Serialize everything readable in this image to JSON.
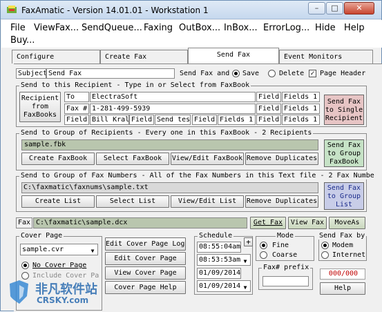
{
  "window": {
    "title": "FaxAmatic - Version 14.01.01 - Workstation 1"
  },
  "menu": [
    "File",
    "ViewFax...",
    "SendQueue...",
    "Faxing",
    "OutBox...",
    "InBox...",
    "ErrorLog...",
    "Hide",
    "Help",
    "Buy..."
  ],
  "tabs": [
    "Configure",
    "Create Fax",
    "Send Fax",
    "Event Monitors"
  ],
  "subject": {
    "label": "Subject",
    "value": "Send Fax"
  },
  "send_fax_and": "Send Fax and",
  "save_label": "Save",
  "delete_label": "Delete",
  "page_header_label": "Page Header",
  "recipient": {
    "caption": "Send to this Recipient - Type in or Select from FaxBook",
    "faxbooks_button": "Recipient from FaxBooks",
    "to_label": "To",
    "to_value": "ElectraSoft",
    "faxnum_label": "Fax #",
    "faxnum_value": "1-281-499-5939",
    "field_label": "Field",
    "field_value_1": "Bill Kral",
    "field_value_2": "Send tes",
    "field_value_3": "Fields 1",
    "right_fields": [
      "Fields 1",
      "Fields 1"
    ],
    "single_button": "Send Fax to Single Recipient"
  },
  "group": {
    "caption": "Send to Group of Recipients - Every one in this FaxBook - 2 Recipients",
    "file": "sample.fbk",
    "buttons": [
      "Create FaxBook",
      "Select FaxBook",
      "View/Edit FaxBook",
      "Remove Duplicates"
    ],
    "send_button": "Send Fax to Group FaxBook"
  },
  "numbers": {
    "caption": "Send to Group of Fax Numbers - All of the Fax Numbers in this Text file - 2 Fax Numbe",
    "file": "C:\\faxmatic\\faxnums\\sample.txt",
    "buttons": [
      "Create List",
      "Select List",
      "View/Edit List",
      "Remove Duplicates"
    ],
    "send_button": "Send Fax to Group List"
  },
  "fax": {
    "label": "Fax",
    "file": "C:\\faxmatic\\sample.dcx",
    "get_button": "Get Fax",
    "view_button": "View Fax",
    "movas_button": "MoveAs"
  },
  "cover": {
    "caption": "Cover Page",
    "selected": "sample.cvr",
    "no_cover": "No Cover Page",
    "include_cover": "Include Cover Pa",
    "buttons": [
      "Edit Cover Page Logo",
      "Edit Cover Page",
      "View Cover Page",
      "Cover Page Help"
    ]
  },
  "schedule": {
    "caption": "Schedule",
    "time1": "08:55:04am",
    "time2": "08:53:53am",
    "date1": "01/09/2014",
    "date2": "01/09/2014",
    "plus": "+"
  },
  "mode": {
    "caption": "Mode",
    "fine": "Fine",
    "coarse": "Coarse"
  },
  "sendby": {
    "caption": "Send Fax by",
    "modem": "Modem",
    "internet": "Internet"
  },
  "prefix": {
    "caption": "Fax# prefix",
    "value": ""
  },
  "counter": "000/000",
  "help_button": "Help",
  "watermark": {
    "cn": "非凡软件站",
    "en": "CRSKY.com"
  },
  "colors": {
    "single_btn": "#e7c5c5",
    "group_btn": "#c6e2c6",
    "list_btn": "#c8cde8",
    "textbox": "#b9c6ae"
  }
}
